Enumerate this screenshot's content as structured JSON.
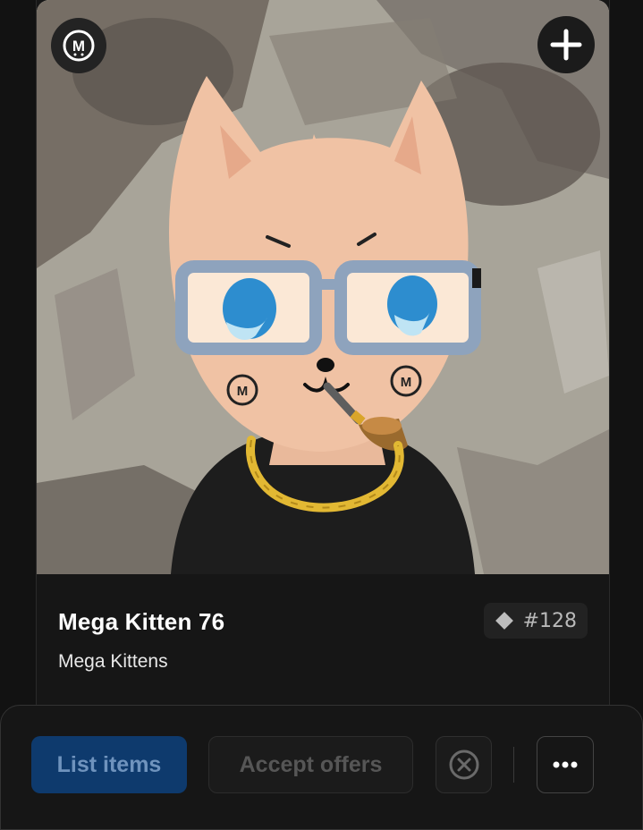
{
  "item": {
    "name": "Mega Kitten 76",
    "collection": "Mega Kittens",
    "token_id": "#128",
    "logo_letter": "M"
  },
  "actions": {
    "list_label": "List items",
    "accept_label": "Accept offers"
  },
  "colors": {
    "background": "#121212",
    "primary_button": "#0e3a6d",
    "primary_text": "#6f93bd"
  },
  "icons": [
    "collection-logo-icon",
    "plus-icon",
    "diamond-icon",
    "cancel-circle-icon",
    "more-dots-icon"
  ]
}
